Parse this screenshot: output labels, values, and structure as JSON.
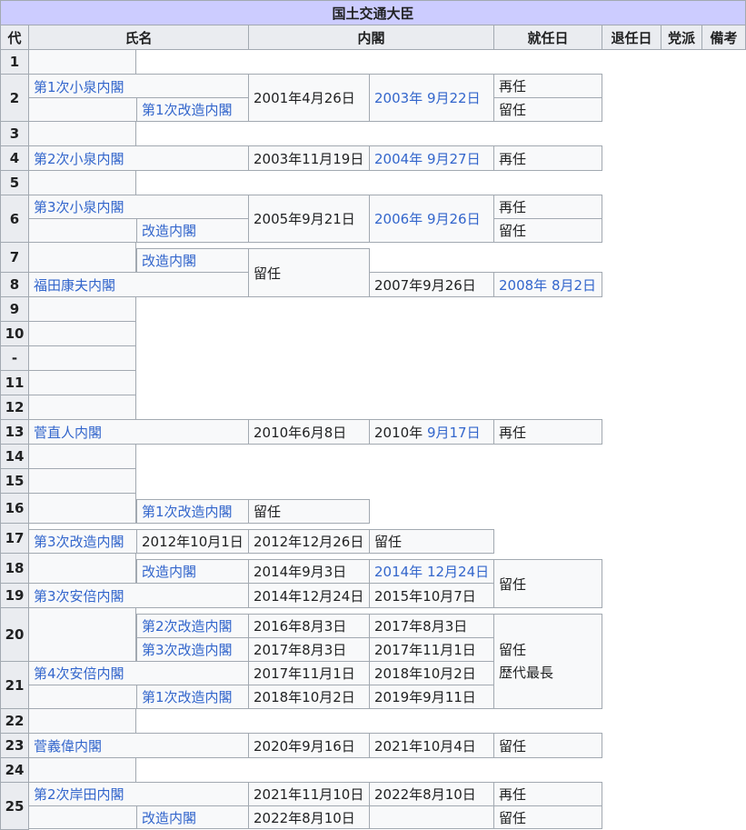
{
  "caption": "国土交通大臣",
  "headers": [
    "代",
    "氏名",
    "内閣",
    "就任日",
    "退任日",
    "党派",
    "備考"
  ],
  "rows": [
    {
      "no": "1",
      "cells": []
    },
    {
      "no": "2",
      "cells": [
        {
          "text": "第1次小泉内閣",
          "link": true
        },
        {
          "text": "2001年4月26日"
        },
        {
          "text": "2003年 9月22日",
          "link": true
        },
        {
          "text": "再任"
        },
        {
          "text": "第1次改造内閣",
          "link": true
        },
        {
          "text": "留任"
        }
      ]
    },
    {
      "no": "3",
      "cells": []
    },
    {
      "no": "4",
      "cells": [
        {
          "text": "第2次小泉内閣",
          "link": true
        },
        {
          "text": "2003年11月19日"
        },
        {
          "text": "2004年 9月27日",
          "link": true
        },
        {
          "text": "再任"
        }
      ]
    },
    {
      "no": "5",
      "cells": []
    },
    {
      "no": "6",
      "cells": [
        {
          "text": "第3次小泉内閣",
          "link": true
        },
        {
          "text": "2005年9月21日"
        },
        {
          "text": "2006年 9月26日",
          "link": true
        },
        {
          "text": "再任"
        },
        {
          "text": "改造内閣",
          "link": true
        },
        {
          "text": "留任"
        }
      ]
    },
    {
      "no": "7",
      "cells": [
        {
          "text": "改造内閣",
          "link": true
        },
        {
          "text": "留任"
        }
      ]
    },
    {
      "no": "8",
      "cells": [
        {
          "text": "福田康夫内閣",
          "link": true
        },
        {
          "text": "2007年9月26日"
        },
        {
          "text": "2008年 8月2日",
          "link": true
        }
      ]
    },
    {
      "no": "9",
      "cells": []
    },
    {
      "no": "10",
      "cells": []
    },
    {
      "no": "-",
      "cells": []
    },
    {
      "no": "11",
      "cells": []
    },
    {
      "no": "12",
      "cells": []
    },
    {
      "no": "13",
      "cells": [
        {
          "text": "菅直人内閣",
          "link": true
        },
        {
          "text": "2010年6月8日"
        },
        {
          "text_a": "2010年 ",
          "text_b": "9月17日",
          "link_b": true
        },
        {
          "text": "再任"
        }
      ]
    },
    {
      "no": "14",
      "cells": []
    },
    {
      "no": "15",
      "cells": []
    },
    {
      "no": "16",
      "cells": [
        {
          "text": "第1次改造内閣",
          "link": true
        },
        {
          "text": "留任"
        }
      ]
    },
    {
      "no": "17",
      "cells": [
        {
          "text": "第3次改造内閣",
          "link": true
        },
        {
          "text": "2012年10月1日"
        },
        {
          "text": "2012年12月26日"
        },
        {
          "text": "留任"
        }
      ]
    },
    {
      "no": "18",
      "cells": [
        {
          "text": "改造内閣",
          "link": true
        },
        {
          "text": "2014年9月3日"
        },
        {
          "text": "2014年 12月24日",
          "link": true
        },
        {
          "text": "留任"
        }
      ]
    },
    {
      "no": "19",
      "cells": [
        {
          "text": "第3次安倍内閣",
          "link": true
        },
        {
          "text": "2014年12月24日"
        },
        {
          "text": "2015年10月7日"
        }
      ]
    },
    {
      "no": "20",
      "cells": [
        {
          "text": "第2次改造内閣",
          "link": true
        },
        {
          "text": "2016年8月3日"
        },
        {
          "text": "2017年8月3日"
        },
        {
          "text": "第3次改造内閣",
          "link": true
        },
        {
          "text": "2017年8月3日"
        },
        {
          "text": "2017年11月1日"
        },
        {
          "line1": "留任",
          "line2": "歴代最長"
        }
      ]
    },
    {
      "no": "21",
      "cells": [
        {
          "text": "第4次安倍内閣",
          "link": true
        },
        {
          "text": "2017年11月1日"
        },
        {
          "text": "2018年10月2日"
        },
        {
          "text": "第1次改造内閣",
          "link": true
        },
        {
          "text": "2018年10月2日"
        },
        {
          "text": "2019年9月11日"
        }
      ]
    },
    {
      "no": "22",
      "cells": []
    },
    {
      "no": "23",
      "cells": [
        {
          "text": "菅義偉内閣",
          "link": true
        },
        {
          "text": "2020年9月16日"
        },
        {
          "text": "2021年10月4日"
        },
        {
          "text": "留任"
        }
      ]
    },
    {
      "no": "24",
      "cells": []
    },
    {
      "no": "25",
      "cells": [
        {
          "text": "第2次岸田内閣",
          "link": true
        },
        {
          "text": "2021年11月10日"
        },
        {
          "text": "2022年8月10日"
        },
        {
          "text": "再任"
        },
        {
          "text": "改造内閣",
          "link": true
        },
        {
          "text": "2022年8月10日"
        },
        {
          "text": ""
        },
        {
          "text": "留任"
        }
      ]
    }
  ]
}
